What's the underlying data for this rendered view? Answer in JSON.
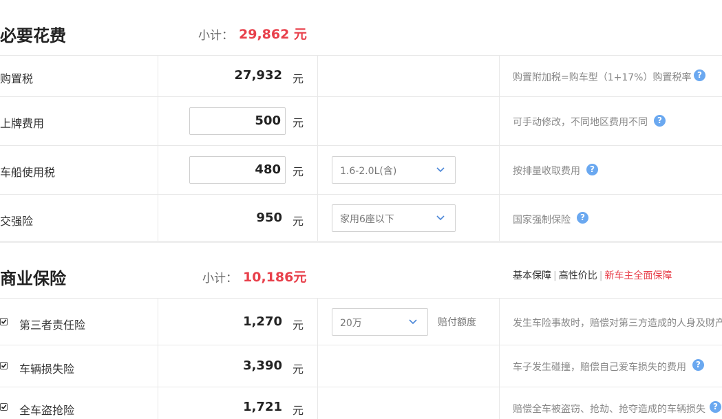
{
  "required": {
    "title": "必要花费",
    "subtotal_label": "小计：",
    "subtotal_value": "29,862 元",
    "rows": [
      {
        "label": "购置税",
        "amount": "27,932",
        "unit": "元",
        "note": "购置附加税=购车型（1+17%）购置税率"
      },
      {
        "label": "上牌费用",
        "amount": "500",
        "unit": "元",
        "note": "可手动修改，不同地区费用不同"
      },
      {
        "label": "车船使用税",
        "amount": "480",
        "unit": "元",
        "select": "1.6-2.0L(含)",
        "note": "按排量收取费用"
      },
      {
        "label": "交强险",
        "amount": "950",
        "unit": "元",
        "select": "家用6座以下",
        "note": "国家强制保险"
      }
    ]
  },
  "commercial": {
    "title": "商业保险",
    "subtotal_label": "小计：",
    "subtotal_value": "10,186元",
    "plans": [
      "基本保障",
      "高性价比",
      "新车主全面保障"
    ],
    "rows": [
      {
        "label": "第三者责任险",
        "checked": true,
        "amount": "1,270",
        "unit": "元",
        "select": "20万",
        "select_suffix": "赔付额度",
        "note": "发生车险事故时，赔偿对第三方造成的人身及财产"
      },
      {
        "label": "车辆损失险",
        "checked": true,
        "amount": "3,390",
        "unit": "元",
        "note": "车子发生碰撞，赔偿自己爱车损失的费用"
      },
      {
        "label": "全车盗抢险",
        "checked": true,
        "amount": "1,721",
        "unit": "元",
        "note": "赔偿全车被盗窃、抢劫、抢夺造成的车辆损失"
      }
    ]
  },
  "icons": {
    "help": "help-question-icon",
    "dropdown": "chevron-down-icon",
    "check": "checkmark-icon"
  },
  "help_glyph": "?",
  "colors": {
    "accent_red": "#e8404b",
    "help_blue": "#6aa8f0",
    "chevron_blue": "#4a86d8"
  }
}
